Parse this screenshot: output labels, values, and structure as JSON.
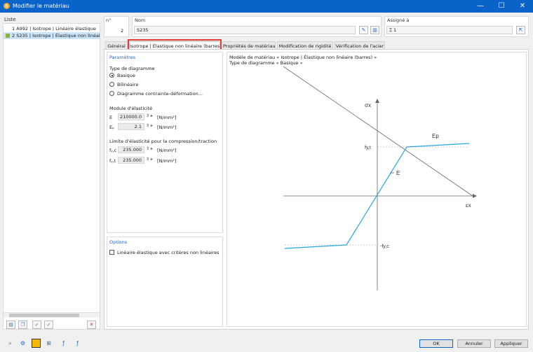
{
  "window": {
    "title": "Modifier le matériau",
    "minimize": "—",
    "maximize": "☐",
    "close": "✕"
  },
  "list": {
    "label": "Liste",
    "items": [
      {
        "num": "1",
        "text": "A992 | Isotrope | Linéaire élastique",
        "color": ""
      },
      {
        "num": "2",
        "text": "S235 | Isotrope | Élastique non linéai",
        "color": "#8db33a"
      }
    ]
  },
  "header": {
    "no_label": "n°",
    "no_value": "2",
    "name_label": "Nom",
    "name_value": "S235",
    "assigned_label": "Assigné à",
    "assigned_value": "1"
  },
  "tabs": [
    {
      "label": "Général"
    },
    {
      "label": "Isotrope | Élastique non linéaire (barres)"
    },
    {
      "label": "Propriétés de matériau"
    },
    {
      "label": "Modification de rigidité"
    },
    {
      "label": "Vérification de l'acier"
    }
  ],
  "params": {
    "title": "Paramètres",
    "diagram_type_label": "Type de diagramme",
    "diagram_types": [
      "Basique",
      "Bilinéaire",
      "Diagramme contrainte-déformation..."
    ],
    "elasticity_label": "Module d'élasticité",
    "E_label": "E",
    "E_value": "210000.0",
    "E_unit": "[N/mm²]",
    "Ep_label": "Eₚ",
    "Ep_value": "2.1",
    "Ep_unit": "[N/mm²]",
    "limit_label": "Limite d'élasticité pour la compression/traction",
    "fyc_label": "fᵧ,c",
    "fyc_value": "235.000",
    "fyc_unit": "[N/mm²]",
    "fyt_label": "fᵧ,t",
    "fyt_value": "235.000",
    "fyt_unit": "[N/mm²]"
  },
  "options": {
    "title": "Options",
    "checkbox_label": "Linéaire élastique avec critères non linéaires"
  },
  "diagram": {
    "line1": "Modèle de matériau « Isotrope | Élastique non linéaire (barres) »",
    "line2": "Type de diagramme « Basique »",
    "sigma_label": "σx",
    "eps_label": "εx",
    "fyt_label": "fy,t",
    "fyc_label": "-fy,c",
    "E_label": "E",
    "Ep_label": "Ep",
    "line_color": "#2aa6dc"
  },
  "buttons": {
    "ok": "OK",
    "cancel": "Annuler",
    "apply": "Appliquer"
  },
  "colors": {
    "titlebar": "#0a63c9",
    "highlight": "#e53935",
    "accent": "#2a62b8"
  }
}
